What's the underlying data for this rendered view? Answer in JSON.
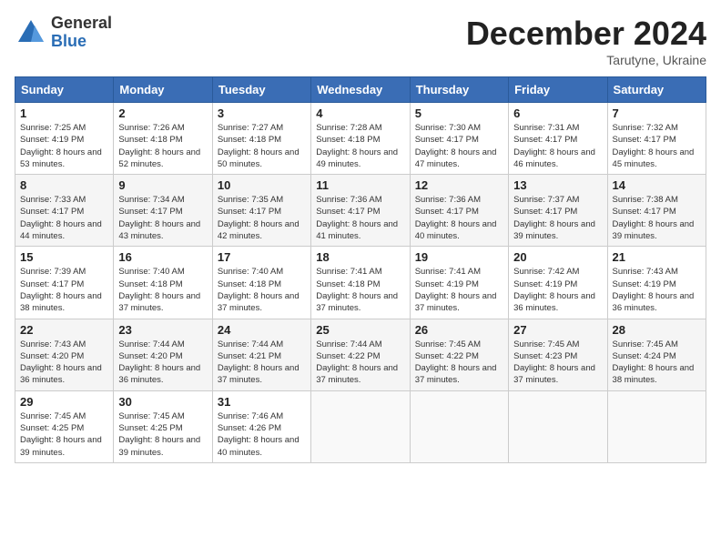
{
  "logo": {
    "general": "General",
    "blue": "Blue"
  },
  "title": "December 2024",
  "subtitle": "Tarutyne, Ukraine",
  "headers": [
    "Sunday",
    "Monday",
    "Tuesday",
    "Wednesday",
    "Thursday",
    "Friday",
    "Saturday"
  ],
  "weeks": [
    [
      {
        "day": "1",
        "sunrise": "7:25 AM",
        "sunset": "4:19 PM",
        "daylight": "8 hours and 53 minutes."
      },
      {
        "day": "2",
        "sunrise": "7:26 AM",
        "sunset": "4:18 PM",
        "daylight": "8 hours and 52 minutes."
      },
      {
        "day": "3",
        "sunrise": "7:27 AM",
        "sunset": "4:18 PM",
        "daylight": "8 hours and 50 minutes."
      },
      {
        "day": "4",
        "sunrise": "7:28 AM",
        "sunset": "4:18 PM",
        "daylight": "8 hours and 49 minutes."
      },
      {
        "day": "5",
        "sunrise": "7:30 AM",
        "sunset": "4:17 PM",
        "daylight": "8 hours and 47 minutes."
      },
      {
        "day": "6",
        "sunrise": "7:31 AM",
        "sunset": "4:17 PM",
        "daylight": "8 hours and 46 minutes."
      },
      {
        "day": "7",
        "sunrise": "7:32 AM",
        "sunset": "4:17 PM",
        "daylight": "8 hours and 45 minutes."
      }
    ],
    [
      {
        "day": "8",
        "sunrise": "7:33 AM",
        "sunset": "4:17 PM",
        "daylight": "8 hours and 44 minutes."
      },
      {
        "day": "9",
        "sunrise": "7:34 AM",
        "sunset": "4:17 PM",
        "daylight": "8 hours and 43 minutes."
      },
      {
        "day": "10",
        "sunrise": "7:35 AM",
        "sunset": "4:17 PM",
        "daylight": "8 hours and 42 minutes."
      },
      {
        "day": "11",
        "sunrise": "7:36 AM",
        "sunset": "4:17 PM",
        "daylight": "8 hours and 41 minutes."
      },
      {
        "day": "12",
        "sunrise": "7:36 AM",
        "sunset": "4:17 PM",
        "daylight": "8 hours and 40 minutes."
      },
      {
        "day": "13",
        "sunrise": "7:37 AM",
        "sunset": "4:17 PM",
        "daylight": "8 hours and 39 minutes."
      },
      {
        "day": "14",
        "sunrise": "7:38 AM",
        "sunset": "4:17 PM",
        "daylight": "8 hours and 39 minutes."
      }
    ],
    [
      {
        "day": "15",
        "sunrise": "7:39 AM",
        "sunset": "4:17 PM",
        "daylight": "8 hours and 38 minutes."
      },
      {
        "day": "16",
        "sunrise": "7:40 AM",
        "sunset": "4:18 PM",
        "daylight": "8 hours and 37 minutes."
      },
      {
        "day": "17",
        "sunrise": "7:40 AM",
        "sunset": "4:18 PM",
        "daylight": "8 hours and 37 minutes."
      },
      {
        "day": "18",
        "sunrise": "7:41 AM",
        "sunset": "4:18 PM",
        "daylight": "8 hours and 37 minutes."
      },
      {
        "day": "19",
        "sunrise": "7:41 AM",
        "sunset": "4:19 PM",
        "daylight": "8 hours and 37 minutes."
      },
      {
        "day": "20",
        "sunrise": "7:42 AM",
        "sunset": "4:19 PM",
        "daylight": "8 hours and 36 minutes."
      },
      {
        "day": "21",
        "sunrise": "7:43 AM",
        "sunset": "4:19 PM",
        "daylight": "8 hours and 36 minutes."
      }
    ],
    [
      {
        "day": "22",
        "sunrise": "7:43 AM",
        "sunset": "4:20 PM",
        "daylight": "8 hours and 36 minutes."
      },
      {
        "day": "23",
        "sunrise": "7:44 AM",
        "sunset": "4:20 PM",
        "daylight": "8 hours and 36 minutes."
      },
      {
        "day": "24",
        "sunrise": "7:44 AM",
        "sunset": "4:21 PM",
        "daylight": "8 hours and 37 minutes."
      },
      {
        "day": "25",
        "sunrise": "7:44 AM",
        "sunset": "4:22 PM",
        "daylight": "8 hours and 37 minutes."
      },
      {
        "day": "26",
        "sunrise": "7:45 AM",
        "sunset": "4:22 PM",
        "daylight": "8 hours and 37 minutes."
      },
      {
        "day": "27",
        "sunrise": "7:45 AM",
        "sunset": "4:23 PM",
        "daylight": "8 hours and 37 minutes."
      },
      {
        "day": "28",
        "sunrise": "7:45 AM",
        "sunset": "4:24 PM",
        "daylight": "8 hours and 38 minutes."
      }
    ],
    [
      {
        "day": "29",
        "sunrise": "7:45 AM",
        "sunset": "4:25 PM",
        "daylight": "8 hours and 39 minutes."
      },
      {
        "day": "30",
        "sunrise": "7:45 AM",
        "sunset": "4:25 PM",
        "daylight": "8 hours and 39 minutes."
      },
      {
        "day": "31",
        "sunrise": "7:46 AM",
        "sunset": "4:26 PM",
        "daylight": "8 hours and 40 minutes."
      },
      null,
      null,
      null,
      null
    ]
  ]
}
